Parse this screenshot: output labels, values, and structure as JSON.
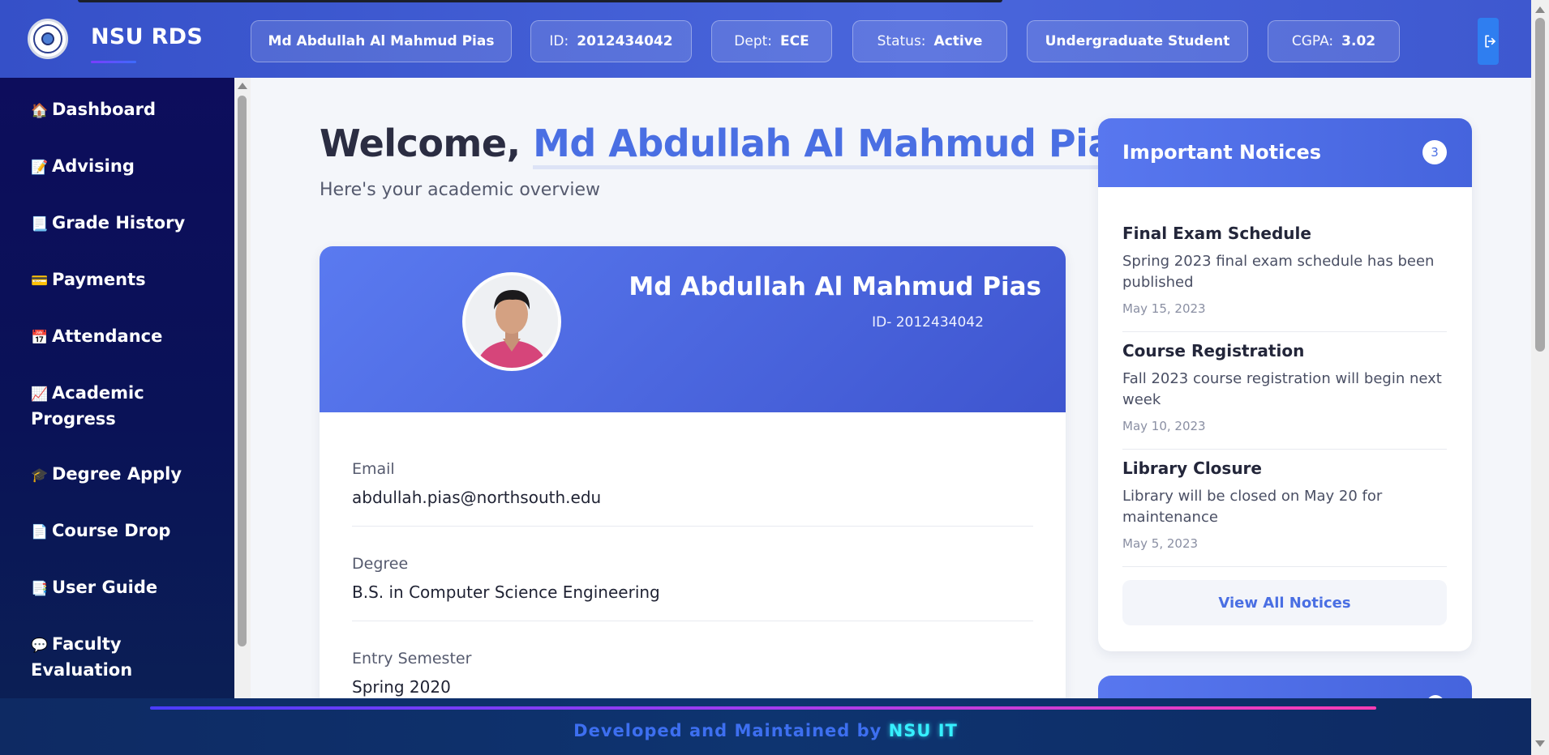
{
  "brand": {
    "name": "NSU RDS",
    "logo_icon": "university-seal-icon"
  },
  "header": {
    "student_name": "Md Abdullah Al Mahmud Pias",
    "id_label": "ID:",
    "id_value": "2012434042",
    "dept_label": "Dept:",
    "dept_value": "ECE",
    "status_label": "Status:",
    "status_value": "Active",
    "level": "Undergraduate Student",
    "cgpa_label": "CGPA:",
    "cgpa_value": "3.02",
    "logout_icon": "logout-icon"
  },
  "sidebar": {
    "items": [
      {
        "icon": "🏠",
        "label": "Dashboard"
      },
      {
        "icon": "📝",
        "label": "Advising"
      },
      {
        "icon": "📃",
        "label": "Grade History"
      },
      {
        "icon": "💳",
        "label": "Payments"
      },
      {
        "icon": "📅",
        "label": "Attendance"
      },
      {
        "icon": "📈",
        "label": "Academic Progress"
      },
      {
        "icon": "🎓",
        "label": "Degree Apply"
      },
      {
        "icon": "📄",
        "label": "Course Drop"
      },
      {
        "icon": "📑",
        "label": "User Guide"
      },
      {
        "icon": "💬",
        "label": "Faculty Evaluation"
      }
    ]
  },
  "main": {
    "welcome_prefix": "Welcome, ",
    "welcome_name": "Md Abdullah Al Mahmud Pias",
    "welcome_suffix": "!",
    "subtitle": "Here's your academic overview",
    "profile": {
      "name": "Md Abdullah Al Mahmud Pias",
      "id_line": "ID- 2012434042",
      "fields": [
        {
          "label": "Email",
          "value": "abdullah.pias@northsouth.edu"
        },
        {
          "label": "Degree",
          "value": "B.S. in Computer Science Engineering"
        },
        {
          "label": "Entry Semester",
          "value": "Spring 2020"
        }
      ]
    },
    "notices": {
      "title": "Important Notices",
      "count": "3",
      "items": [
        {
          "title": "Final Exam Schedule",
          "desc": "Spring 2023 final exam schedule has been published",
          "date": "May 15, 2023"
        },
        {
          "title": "Course Registration",
          "desc": "Fall 2023 course registration will begin next week",
          "date": "May 10, 2023"
        },
        {
          "title": "Library Closure",
          "desc": "Library will be closed on May 20 for maintenance",
          "date": "May 5, 2023"
        }
      ],
      "view_all": "View All Notices"
    }
  },
  "footer": {
    "prefix": "Developed and Maintained by ",
    "org": "NSU IT"
  },
  "colors": {
    "accent": "#4a6fe3",
    "sidebar": "#0d0d5c",
    "footer_highlight": "#36f0ff"
  }
}
